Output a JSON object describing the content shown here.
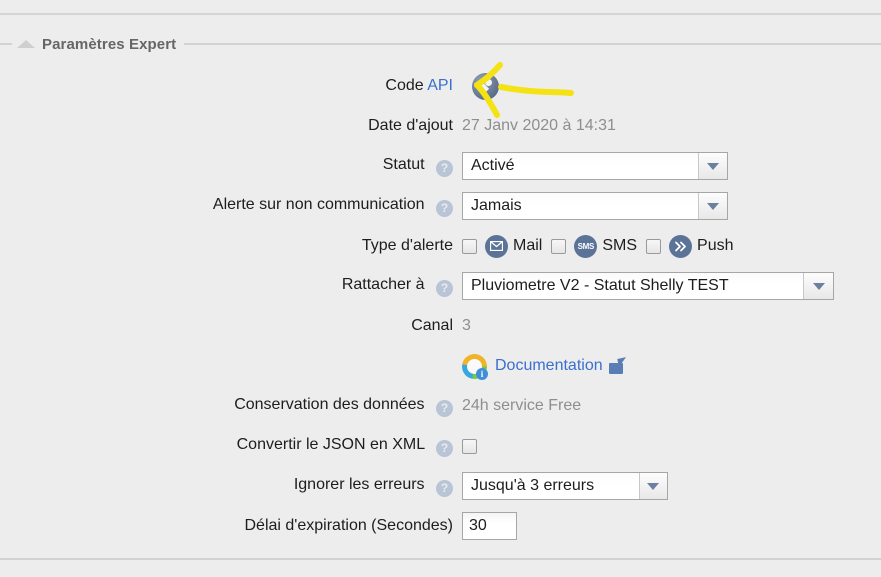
{
  "panel": {
    "legend": "Paramètres Expert",
    "collapse_icon": "triangle-up-icon"
  },
  "fields": {
    "code_api": {
      "label": "Code",
      "link_label": "API",
      "icon": "api-key-icon"
    },
    "date_ajout": {
      "label": "Date d'ajout",
      "value": "27 Janv 2020 à 14:31"
    },
    "statut": {
      "label": "Statut",
      "help": "?",
      "value": "Activé"
    },
    "alerte_non_communication": {
      "label": "Alerte sur non communication",
      "help": "?",
      "value": "Jamais"
    },
    "type_alerte": {
      "label": "Type d'alerte",
      "options": [
        {
          "label": "Mail",
          "icon": "mail-icon",
          "glyph": "✉",
          "checked": false
        },
        {
          "label": "SMS",
          "icon": "sms-icon",
          "glyph": "SMS",
          "checked": false
        },
        {
          "label": "Push",
          "icon": "push-icon",
          "glyph": "»",
          "checked": false
        }
      ]
    },
    "rattacher_a": {
      "label": "Rattacher à",
      "help": "?",
      "value": "Pluviometre V2 - Statut Shelly TEST"
    },
    "canal": {
      "label": "Canal",
      "value": "3"
    },
    "documentation": {
      "link_label": "Documentation",
      "icon": "documentation-info-icon",
      "external_icon": "external-link-icon"
    },
    "conservation_donnees": {
      "label": "Conservation des données",
      "help": "?",
      "value": "24h service Free"
    },
    "convertir_json_xml": {
      "label": "Convertir le JSON en XML",
      "help": "?",
      "checked": false
    },
    "ignorer_erreurs": {
      "label": "Ignorer les erreurs",
      "help": "?",
      "value": "Jusqu'à 3 erreurs"
    },
    "delai_expiration": {
      "label": "Délai d'expiration (Secondes)",
      "value": "30"
    }
  },
  "annotation": {
    "type": "hand-drawn-arrow",
    "color": "#f5e214",
    "points_at": "api-key-icon"
  },
  "colors": {
    "background": "#ededed",
    "link": "#3a6fd0",
    "muted_text": "#8e8e8e",
    "legend_text": "#666666",
    "icon_blue": "#5b7397",
    "annotation_yellow": "#f5e214"
  }
}
